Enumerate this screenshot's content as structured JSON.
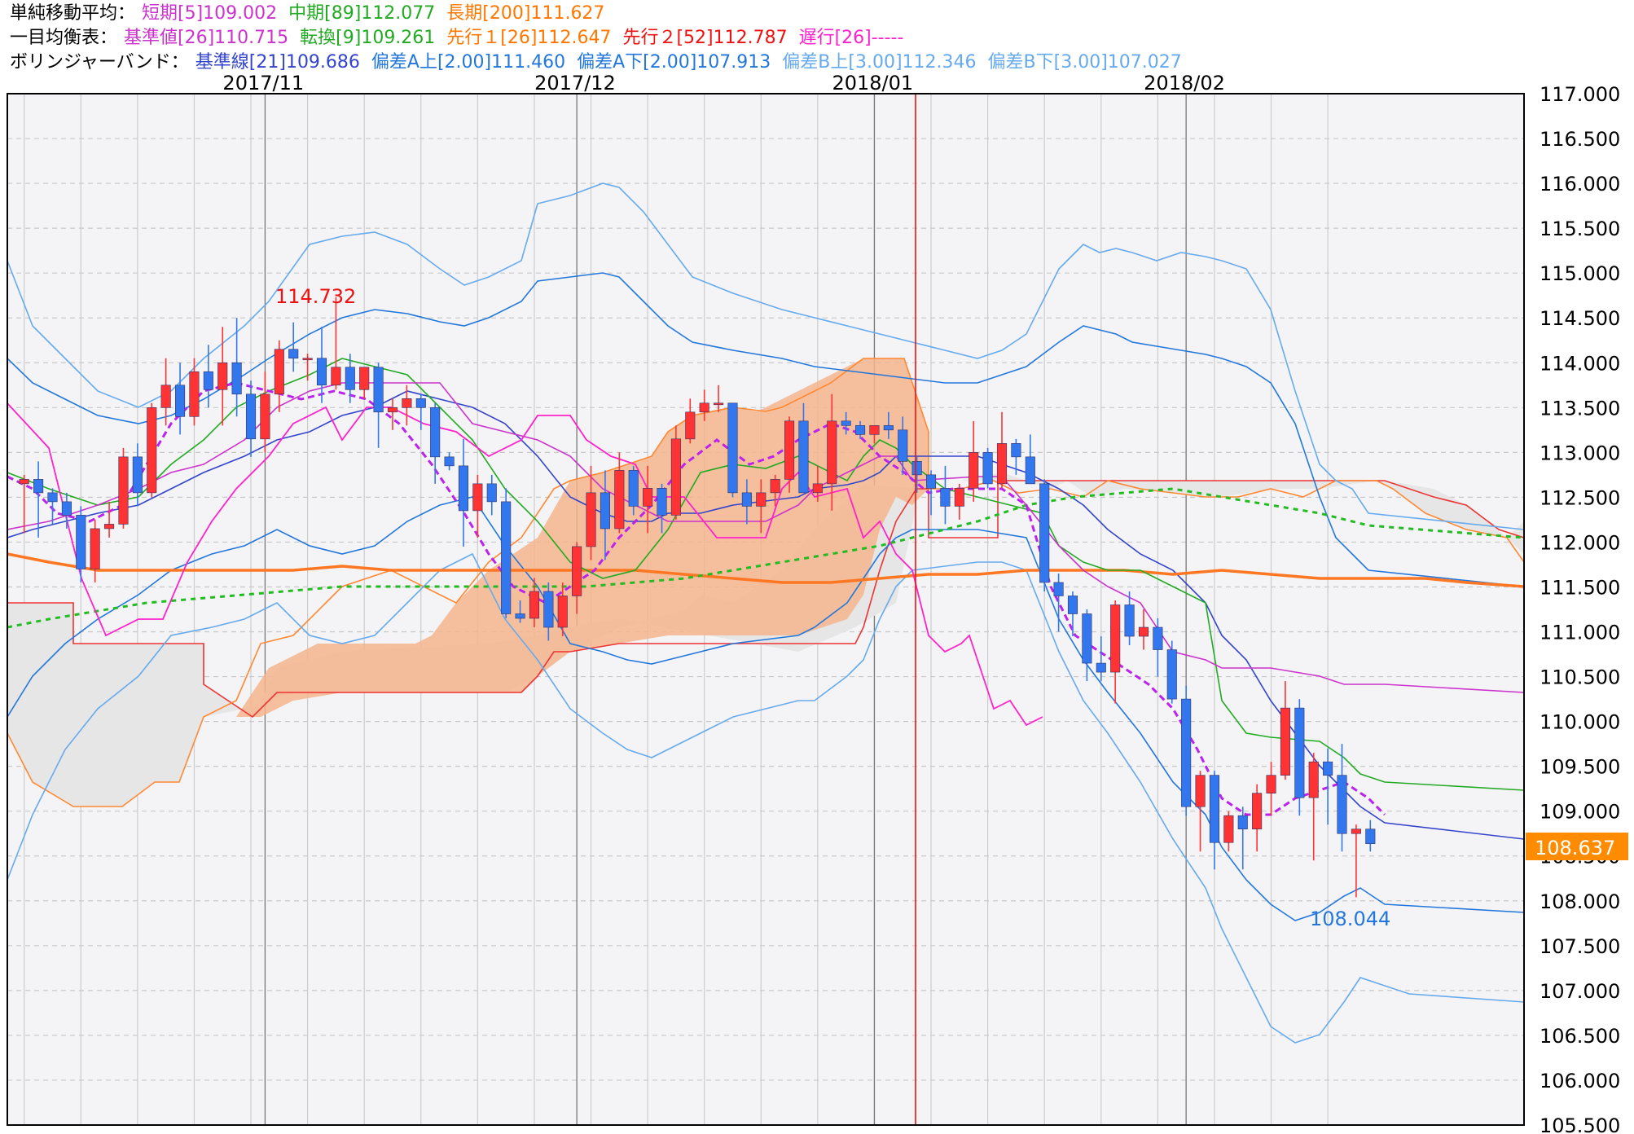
{
  "legend": {
    "sma": {
      "label": "単純移動平均：",
      "short": {
        "text": "短期[5]109.002",
        "color": "#cc33cc"
      },
      "mid": {
        "text": "中期[89]112.077",
        "color": "#22aa22"
      },
      "long": {
        "text": "長期[200]111.627",
        "color": "#ff7700"
      }
    },
    "ichimoku": {
      "label": "一目均衡表：",
      "kijun": {
        "text": "基準値[26]110.715",
        "color": "#cc33cc"
      },
      "tenkan": {
        "text": "転換[9]109.261",
        "color": "#22aa22"
      },
      "senkou1": {
        "text": "先行１[26]112.647",
        "color": "#ff7700"
      },
      "senkou2": {
        "text": "先行２[52]112.787",
        "color": "#ee1111"
      },
      "chikou": {
        "text": "遅行[26]-----",
        "color": "#ff22cc"
      }
    },
    "bollinger": {
      "label": "ボリンジャーバンド：",
      "mid": {
        "text": "基準線[21]109.686",
        "color": "#3344cc"
      },
      "a_up": {
        "text": "偏差A上[2.00]111.460",
        "color": "#2277dd"
      },
      "a_dn": {
        "text": "偏差A下[2.00]107.913",
        "color": "#2277dd"
      },
      "b_up": {
        "text": "偏差B上[3.00]112.346",
        "color": "#66aaee"
      },
      "b_dn": {
        "text": "偏差B下[3.00]107.027",
        "color": "#66aaee"
      }
    }
  },
  "annotations": {
    "high_label": "114.732",
    "low_label": "108.044",
    "current_price": "108.637"
  },
  "colors": {
    "up": "#ff3333",
    "down": "#3377ee",
    "cloud_up": "#f5b48c",
    "cloud_down": "#e6e6e6",
    "current_bg": "#ff8c00",
    "vline": "#ee1111"
  },
  "chart_data": {
    "type": "candlestick",
    "ylim": [
      105.5,
      117.0
    ],
    "y_ticks": [
      "117.000",
      "116.500",
      "116.000",
      "115.500",
      "115.000",
      "114.500",
      "114.000",
      "113.500",
      "113.000",
      "112.500",
      "112.000",
      "111.500",
      "111.000",
      "110.500",
      "110.000",
      "109.500",
      "109.000",
      "108.500",
      "108.000",
      "107.500",
      "107.000",
      "106.500",
      "106.000",
      "105.500"
    ],
    "x_labels": [
      {
        "text": "2017/11",
        "index": 17
      },
      {
        "text": "2017/12",
        "index": 39
      },
      {
        "text": "2018/01",
        "index": 60
      },
      {
        "text": "2018/02",
        "index": 82
      }
    ],
    "grid": true,
    "candles": [
      {
        "o": 112.65,
        "h": 112.75,
        "l": 112.1,
        "c": 112.7
      },
      {
        "o": 112.7,
        "h": 112.9,
        "l": 112.05,
        "c": 112.55
      },
      {
        "o": 112.55,
        "h": 112.6,
        "l": 112.2,
        "c": 112.45
      },
      {
        "o": 112.45,
        "h": 112.55,
        "l": 112.15,
        "c": 112.3
      },
      {
        "o": 112.3,
        "h": 112.4,
        "l": 111.55,
        "c": 111.7
      },
      {
        "o": 111.7,
        "h": 112.25,
        "l": 111.55,
        "c": 112.15
      },
      {
        "o": 112.15,
        "h": 112.45,
        "l": 112.05,
        "c": 112.2
      },
      {
        "o": 112.2,
        "h": 113.05,
        "l": 112.15,
        "c": 112.95
      },
      {
        "o": 112.95,
        "h": 113.1,
        "l": 112.4,
        "c": 112.55
      },
      {
        "o": 112.55,
        "h": 113.55,
        "l": 112.5,
        "c": 113.5
      },
      {
        "o": 113.5,
        "h": 114.05,
        "l": 113.3,
        "c": 113.75
      },
      {
        "o": 113.75,
        "h": 114.0,
        "l": 113.2,
        "c": 113.4
      },
      {
        "o": 113.4,
        "h": 114.05,
        "l": 113.3,
        "c": 113.9
      },
      {
        "o": 113.9,
        "h": 114.2,
        "l": 113.5,
        "c": 113.7
      },
      {
        "o": 113.7,
        "h": 114.4,
        "l": 113.3,
        "c": 114.0
      },
      {
        "o": 114.0,
        "h": 114.5,
        "l": 113.4,
        "c": 113.65
      },
      {
        "o": 113.65,
        "h": 113.8,
        "l": 112.95,
        "c": 113.15
      },
      {
        "o": 113.15,
        "h": 113.9,
        "l": 113.0,
        "c": 113.65
      },
      {
        "o": 113.65,
        "h": 114.25,
        "l": 113.45,
        "c": 114.15
      },
      {
        "o": 114.15,
        "h": 114.45,
        "l": 113.9,
        "c": 114.05
      },
      {
        "o": 114.05,
        "h": 114.1,
        "l": 113.8,
        "c": 114.05
      },
      {
        "o": 114.05,
        "h": 114.4,
        "l": 113.55,
        "c": 113.75
      },
      {
        "o": 113.75,
        "h": 114.73,
        "l": 113.7,
        "c": 113.95
      },
      {
        "o": 113.95,
        "h": 114.1,
        "l": 113.55,
        "c": 113.7
      },
      {
        "o": 113.7,
        "h": 113.95,
        "l": 113.6,
        "c": 113.95
      },
      {
        "o": 113.95,
        "h": 114.0,
        "l": 113.05,
        "c": 113.45
      },
      {
        "o": 113.45,
        "h": 113.6,
        "l": 113.25,
        "c": 113.5
      },
      {
        "o": 113.5,
        "h": 113.75,
        "l": 113.3,
        "c": 113.6
      },
      {
        "o": 113.6,
        "h": 113.65,
        "l": 113.25,
        "c": 113.5
      },
      {
        "o": 113.5,
        "h": 113.55,
        "l": 112.65,
        "c": 112.95
      },
      {
        "o": 112.95,
        "h": 113.0,
        "l": 112.8,
        "c": 112.85
      },
      {
        "o": 112.85,
        "h": 113.15,
        "l": 111.95,
        "c": 112.35
      },
      {
        "o": 112.35,
        "h": 112.75,
        "l": 112.05,
        "c": 112.65
      },
      {
        "o": 112.65,
        "h": 112.75,
        "l": 112.3,
        "c": 112.45
      },
      {
        "o": 112.45,
        "h": 112.6,
        "l": 111.15,
        "c": 111.2
      },
      {
        "o": 111.2,
        "h": 111.35,
        "l": 111.1,
        "c": 111.15
      },
      {
        "o": 111.15,
        "h": 111.6,
        "l": 111.05,
        "c": 111.45
      },
      {
        "o": 111.45,
        "h": 111.55,
        "l": 110.9,
        "c": 111.05
      },
      {
        "o": 111.05,
        "h": 111.55,
        "l": 110.95,
        "c": 111.4
      },
      {
        "o": 111.4,
        "h": 112.0,
        "l": 111.2,
        "c": 111.95
      },
      {
        "o": 111.95,
        "h": 112.85,
        "l": 111.8,
        "c": 112.55
      },
      {
        "o": 112.55,
        "h": 112.8,
        "l": 111.8,
        "c": 112.15
      },
      {
        "o": 112.15,
        "h": 113.0,
        "l": 112.1,
        "c": 112.8
      },
      {
        "o": 112.8,
        "h": 112.85,
        "l": 112.3,
        "c": 112.4
      },
      {
        "o": 112.4,
        "h": 112.85,
        "l": 112.1,
        "c": 112.6
      },
      {
        "o": 112.6,
        "h": 112.65,
        "l": 112.1,
        "c": 112.3
      },
      {
        "o": 112.3,
        "h": 113.3,
        "l": 112.25,
        "c": 113.15
      },
      {
        "o": 113.15,
        "h": 113.6,
        "l": 113.1,
        "c": 113.45
      },
      {
        "o": 113.45,
        "h": 113.7,
        "l": 113.35,
        "c": 113.55
      },
      {
        "o": 113.55,
        "h": 113.75,
        "l": 113.45,
        "c": 113.55
      },
      {
        "o": 113.55,
        "h": 113.55,
        "l": 112.5,
        "c": 112.55
      },
      {
        "o": 112.55,
        "h": 112.7,
        "l": 112.2,
        "c": 112.4
      },
      {
        "o": 112.4,
        "h": 112.7,
        "l": 112.1,
        "c": 112.55
      },
      {
        "o": 112.55,
        "h": 112.75,
        "l": 112.4,
        "c": 112.7
      },
      {
        "o": 112.7,
        "h": 113.4,
        "l": 112.55,
        "c": 113.35
      },
      {
        "o": 113.35,
        "h": 113.55,
        "l": 112.85,
        "c": 112.55
      },
      {
        "o": 112.55,
        "h": 112.85,
        "l": 112.45,
        "c": 112.65
      },
      {
        "o": 112.65,
        "h": 113.65,
        "l": 112.35,
        "c": 113.35
      },
      {
        "o": 113.35,
        "h": 113.45,
        "l": 113.2,
        "c": 113.3
      },
      {
        "o": 113.3,
        "h": 113.35,
        "l": 113.15,
        "c": 113.2
      },
      {
        "o": 113.2,
        "h": 113.3,
        "l": 113.1,
        "c": 113.3
      },
      {
        "o": 113.3,
        "h": 113.45,
        "l": 113.15,
        "c": 113.25
      },
      {
        "o": 113.25,
        "h": 113.4,
        "l": 112.75,
        "c": 112.9
      },
      {
        "o": 112.9,
        "h": 112.95,
        "l": 112.55,
        "c": 112.75
      },
      {
        "o": 112.75,
        "h": 112.8,
        "l": 112.3,
        "c": 112.6
      },
      {
        "o": 112.6,
        "h": 112.85,
        "l": 112.2,
        "c": 112.4
      },
      {
        "o": 112.4,
        "h": 112.65,
        "l": 112.25,
        "c": 112.6
      },
      {
        "o": 112.6,
        "h": 113.35,
        "l": 112.45,
        "c": 113.0
      },
      {
        "o": 113.0,
        "h": 113.05,
        "l": 112.6,
        "c": 112.65
      },
      {
        "o": 112.65,
        "h": 113.45,
        "l": 112.6,
        "c": 113.1
      },
      {
        "o": 113.1,
        "h": 113.15,
        "l": 112.75,
        "c": 112.95
      },
      {
        "o": 112.95,
        "h": 113.2,
        "l": 112.7,
        "c": 112.65
      },
      {
        "o": 112.65,
        "h": 112.7,
        "l": 111.45,
        "c": 111.55
      },
      {
        "o": 111.55,
        "h": 111.65,
        "l": 111.0,
        "c": 111.4
      },
      {
        "o": 111.4,
        "h": 111.45,
        "l": 110.95,
        "c": 111.2
      },
      {
        "o": 111.2,
        "h": 111.25,
        "l": 110.45,
        "c": 110.65
      },
      {
        "o": 110.65,
        "h": 110.95,
        "l": 110.45,
        "c": 110.55
      },
      {
        "o": 110.55,
        "h": 111.35,
        "l": 110.2,
        "c": 111.3
      },
      {
        "o": 111.3,
        "h": 111.45,
        "l": 110.85,
        "c": 110.95
      },
      {
        "o": 110.95,
        "h": 111.25,
        "l": 110.8,
        "c": 111.05
      },
      {
        "o": 111.05,
        "h": 111.15,
        "l": 110.5,
        "c": 110.8
      },
      {
        "o": 110.8,
        "h": 110.9,
        "l": 110.2,
        "c": 110.25
      },
      {
        "o": 110.25,
        "h": 110.4,
        "l": 108.95,
        "c": 109.05
      },
      {
        "o": 109.05,
        "h": 109.45,
        "l": 108.55,
        "c": 109.4
      },
      {
        "o": 109.4,
        "h": 109.45,
        "l": 108.35,
        "c": 108.65
      },
      {
        "o": 108.65,
        "h": 109.0,
        "l": 108.55,
        "c": 108.95
      },
      {
        "o": 108.95,
        "h": 109.05,
        "l": 108.35,
        "c": 108.8
      },
      {
        "o": 108.8,
        "h": 109.3,
        "l": 108.55,
        "c": 109.2
      },
      {
        "o": 109.2,
        "h": 109.55,
        "l": 108.95,
        "c": 109.4
      },
      {
        "o": 109.4,
        "h": 110.45,
        "l": 109.35,
        "c": 110.15
      },
      {
        "o": 110.15,
        "h": 110.25,
        "l": 108.95,
        "c": 109.15
      },
      {
        "o": 109.15,
        "h": 109.65,
        "l": 108.45,
        "c": 109.55
      },
      {
        "o": 109.55,
        "h": 109.7,
        "l": 108.85,
        "c": 109.4
      },
      {
        "o": 109.4,
        "h": 109.75,
        "l": 108.55,
        "c": 108.75
      },
      {
        "o": 108.75,
        "h": 108.85,
        "l": 108.04,
        "c": 108.8
      },
      {
        "o": 108.8,
        "h": 108.9,
        "l": 108.55,
        "c": 108.637
      }
    ]
  }
}
